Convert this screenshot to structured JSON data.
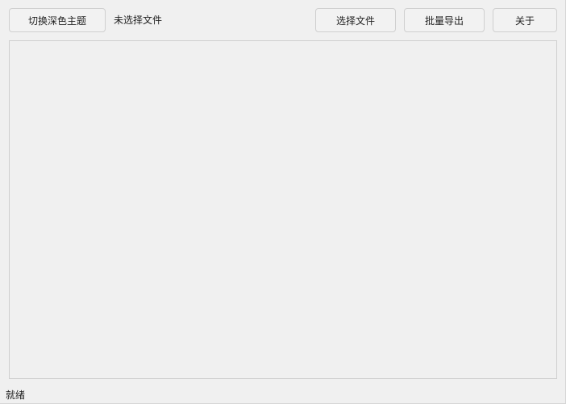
{
  "toolbar": {
    "theme_toggle_label": "切换深色主题",
    "file_status": "未选择文件",
    "select_file_label": "选择文件",
    "batch_export_label": "批量导出",
    "about_label": "关于"
  },
  "status_bar": {
    "text": "就绪"
  }
}
